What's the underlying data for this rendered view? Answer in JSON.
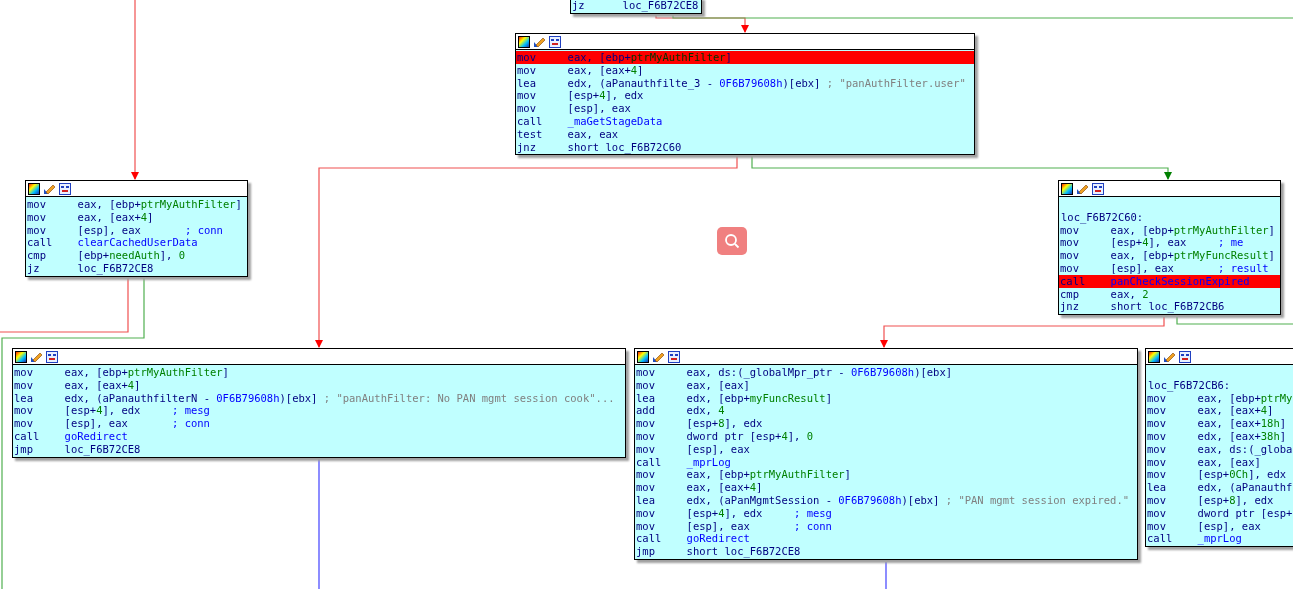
{
  "blocks": [
    {
      "lines": [
        {
          "kind": "instr",
          "mnemonic": "jz",
          "highlighted": false,
          "operands": [
            {
              "t": "loc_F6B72CE8",
              "kind": "op"
            }
          ]
        }
      ]
    },
    {
      "lines": [
        {
          "kind": "instr",
          "mnemonic": "mov",
          "highlighted": true,
          "operands": [
            {
              "t": "eax, [ebp+",
              "kind": "op"
            },
            {
              "t": "ptrMyAuthFilter",
              "kind": "var"
            },
            {
              "t": "]",
              "kind": "op"
            }
          ]
        },
        {
          "kind": "instr",
          "mnemonic": "mov",
          "highlighted": false,
          "operands": [
            {
              "t": "eax, [eax+",
              "kind": "op"
            },
            {
              "t": "4",
              "kind": "var"
            },
            {
              "t": "]",
              "kind": "op"
            }
          ]
        },
        {
          "kind": "instr",
          "mnemonic": "lea",
          "highlighted": false,
          "operands": [
            {
              "t": "edx, (aPanauthfilte_3 - ",
              "kind": "op"
            },
            {
              "t": "0F6B79608h",
              "kind": "func"
            },
            {
              "t": ")[ebx]",
              "kind": "op"
            }
          ],
          "comment": [
            {
              "t": "; \"panAuthFilter.user\"",
              "kind": "string"
            }
          ]
        },
        {
          "kind": "instr",
          "mnemonic": "mov",
          "highlighted": false,
          "operands": [
            {
              "t": "[esp+",
              "kind": "op"
            },
            {
              "t": "4",
              "kind": "var"
            },
            {
              "t": "], edx",
              "kind": "op"
            }
          ]
        },
        {
          "kind": "instr",
          "mnemonic": "mov",
          "highlighted": false,
          "operands": [
            {
              "t": "[esp], eax",
              "kind": "op"
            }
          ]
        },
        {
          "kind": "instr",
          "mnemonic": "call",
          "highlighted": false,
          "operands": [
            {
              "t": "_maGetStageData",
              "kind": "func"
            }
          ]
        },
        {
          "kind": "instr",
          "mnemonic": "test",
          "highlighted": false,
          "operands": [
            {
              "t": "eax, eax",
              "kind": "op"
            }
          ]
        },
        {
          "kind": "instr",
          "mnemonic": "jnz",
          "highlighted": false,
          "operands": [
            {
              "t": "short loc_F6B72C60",
              "kind": "op"
            }
          ]
        }
      ]
    },
    {
      "lines": [
        {
          "kind": "instr",
          "mnemonic": "mov",
          "highlighted": false,
          "operands": [
            {
              "t": "eax, [ebp+",
              "kind": "op"
            },
            {
              "t": "ptrMyAuthFilter",
              "kind": "var"
            },
            {
              "t": "]",
              "kind": "op"
            }
          ]
        },
        {
          "kind": "instr",
          "mnemonic": "mov",
          "highlighted": false,
          "operands": [
            {
              "t": "eax, [eax+",
              "kind": "op"
            },
            {
              "t": "4",
              "kind": "var"
            },
            {
              "t": "]",
              "kind": "op"
            }
          ]
        },
        {
          "kind": "instr",
          "mnemonic": "mov",
          "highlighted": false,
          "operands": [
            {
              "t": "[esp], eax",
              "kind": "op"
            }
          ],
          "comment": [
            {
              "t": "; conn",
              "kind": "comment"
            }
          ]
        },
        {
          "kind": "instr",
          "mnemonic": "call",
          "highlighted": false,
          "operands": [
            {
              "t": "clearCachedUserData",
              "kind": "func"
            }
          ]
        },
        {
          "kind": "instr",
          "mnemonic": "cmp",
          "highlighted": false,
          "operands": [
            {
              "t": "[ebp+",
              "kind": "op"
            },
            {
              "t": "needAuth",
              "kind": "var"
            },
            {
              "t": "], ",
              "kind": "op"
            },
            {
              "t": "0",
              "kind": "var"
            }
          ]
        },
        {
          "kind": "instr",
          "mnemonic": "jz",
          "highlighted": false,
          "operands": [
            {
              "t": "loc_F6B72CE8",
              "kind": "op"
            }
          ]
        }
      ]
    },
    {
      "lines": [
        {
          "kind": "blank"
        },
        {
          "kind": "label",
          "label": "loc_F6B72C60:"
        },
        {
          "kind": "instr",
          "mnemonic": "mov",
          "highlighted": false,
          "operands": [
            {
              "t": "eax, [ebp+",
              "kind": "op"
            },
            {
              "t": "ptrMyAuthFilter",
              "kind": "var"
            },
            {
              "t": "]",
              "kind": "op"
            }
          ]
        },
        {
          "kind": "instr",
          "mnemonic": "mov",
          "highlighted": false,
          "operands": [
            {
              "t": "[esp+",
              "kind": "op"
            },
            {
              "t": "4",
              "kind": "var"
            },
            {
              "t": "], eax",
              "kind": "op"
            }
          ],
          "comment": [
            {
              "t": "; me",
              "kind": "comment"
            }
          ]
        },
        {
          "kind": "instr",
          "mnemonic": "mov",
          "highlighted": false,
          "operands": [
            {
              "t": "eax, [ebp+",
              "kind": "op"
            },
            {
              "t": "ptrMyFuncResult",
              "kind": "var"
            },
            {
              "t": "]",
              "kind": "op"
            }
          ]
        },
        {
          "kind": "instr",
          "mnemonic": "mov",
          "highlighted": false,
          "operands": [
            {
              "t": "[esp], eax",
              "kind": "op"
            }
          ],
          "comment": [
            {
              "t": "; result",
              "kind": "comment"
            }
          ]
        },
        {
          "kind": "instr",
          "mnemonic": "call",
          "highlighted": true,
          "operands": [
            {
              "t": "panCheckSessionExpired",
              "kind": "func"
            }
          ]
        },
        {
          "kind": "instr",
          "mnemonic": "cmp",
          "highlighted": false,
          "operands": [
            {
              "t": "eax, ",
              "kind": "op"
            },
            {
              "t": "2",
              "kind": "var"
            }
          ]
        },
        {
          "kind": "instr",
          "mnemonic": "jnz",
          "highlighted": false,
          "operands": [
            {
              "t": "short loc_F6B72CB6",
              "kind": "op"
            }
          ]
        }
      ]
    },
    {
      "lines": [
        {
          "kind": "instr",
          "mnemonic": "mov",
          "highlighted": false,
          "operands": [
            {
              "t": "eax, [ebp+",
              "kind": "op"
            },
            {
              "t": "ptrMyAuthFilter",
              "kind": "var"
            },
            {
              "t": "]",
              "kind": "op"
            }
          ]
        },
        {
          "kind": "instr",
          "mnemonic": "mov",
          "highlighted": false,
          "operands": [
            {
              "t": "eax, [eax+",
              "kind": "op"
            },
            {
              "t": "4",
              "kind": "var"
            },
            {
              "t": "]",
              "kind": "op"
            }
          ]
        },
        {
          "kind": "instr",
          "mnemonic": "lea",
          "highlighted": false,
          "operands": [
            {
              "t": "edx, (aPanauthfilterN - ",
              "kind": "op"
            },
            {
              "t": "0F6B79608h",
              "kind": "func"
            },
            {
              "t": ")[ebx]",
              "kind": "op"
            }
          ],
          "comment": [
            {
              "t": "; \"panAuthFilter: No PAN mgmt session cook\"...",
              "kind": "string"
            }
          ]
        },
        {
          "kind": "instr",
          "mnemonic": "mov",
          "highlighted": false,
          "operands": [
            {
              "t": "[esp+",
              "kind": "op"
            },
            {
              "t": "4",
              "kind": "var"
            },
            {
              "t": "], edx",
              "kind": "op"
            }
          ],
          "comment": [
            {
              "t": "; mesg",
              "kind": "comment"
            }
          ]
        },
        {
          "kind": "instr",
          "mnemonic": "mov",
          "highlighted": false,
          "operands": [
            {
              "t": "[esp], eax",
              "kind": "op"
            }
          ],
          "comment": [
            {
              "t": "; conn",
              "kind": "comment"
            }
          ]
        },
        {
          "kind": "instr",
          "mnemonic": "call",
          "highlighted": false,
          "operands": [
            {
              "t": "goRedirect",
              "kind": "func"
            }
          ]
        },
        {
          "kind": "instr",
          "mnemonic": "jmp",
          "highlighted": false,
          "operands": [
            {
              "t": "loc_F6B72CE8",
              "kind": "op"
            }
          ]
        }
      ]
    },
    {
      "lines": [
        {
          "kind": "instr",
          "mnemonic": "mov",
          "highlighted": false,
          "operands": [
            {
              "t": "eax, ds:(_globalMpr_ptr - ",
              "kind": "op"
            },
            {
              "t": "0F6B79608h",
              "kind": "func"
            },
            {
              "t": ")[ebx]",
              "kind": "op"
            }
          ]
        },
        {
          "kind": "instr",
          "mnemonic": "mov",
          "highlighted": false,
          "operands": [
            {
              "t": "eax, [eax]",
              "kind": "op"
            }
          ]
        },
        {
          "kind": "instr",
          "mnemonic": "lea",
          "highlighted": false,
          "operands": [
            {
              "t": "edx, [ebp+",
              "kind": "op"
            },
            {
              "t": "myFuncResult",
              "kind": "var"
            },
            {
              "t": "]",
              "kind": "op"
            }
          ]
        },
        {
          "kind": "instr",
          "mnemonic": "add",
          "highlighted": false,
          "operands": [
            {
              "t": "edx, ",
              "kind": "op"
            },
            {
              "t": "4",
              "kind": "var"
            }
          ]
        },
        {
          "kind": "instr",
          "mnemonic": "mov",
          "highlighted": false,
          "operands": [
            {
              "t": "[esp+",
              "kind": "op"
            },
            {
              "t": "8",
              "kind": "var"
            },
            {
              "t": "], edx",
              "kind": "op"
            }
          ]
        },
        {
          "kind": "instr",
          "mnemonic": "mov",
          "highlighted": false,
          "operands": [
            {
              "t": "dword ptr [esp+",
              "kind": "op"
            },
            {
              "t": "4",
              "kind": "var"
            },
            {
              "t": "], ",
              "kind": "op"
            },
            {
              "t": "0",
              "kind": "var"
            }
          ]
        },
        {
          "kind": "instr",
          "mnemonic": "mov",
          "highlighted": false,
          "operands": [
            {
              "t": "[esp], eax",
              "kind": "op"
            }
          ]
        },
        {
          "kind": "instr",
          "mnemonic": "call",
          "highlighted": false,
          "operands": [
            {
              "t": "_mprLog",
              "kind": "func"
            }
          ]
        },
        {
          "kind": "instr",
          "mnemonic": "mov",
          "highlighted": false,
          "operands": [
            {
              "t": "eax, [ebp+",
              "kind": "op"
            },
            {
              "t": "ptrMyAuthFilter",
              "kind": "var"
            },
            {
              "t": "]",
              "kind": "op"
            }
          ]
        },
        {
          "kind": "instr",
          "mnemonic": "mov",
          "highlighted": false,
          "operands": [
            {
              "t": "eax, [eax+",
              "kind": "op"
            },
            {
              "t": "4",
              "kind": "var"
            },
            {
              "t": "]",
              "kind": "op"
            }
          ]
        },
        {
          "kind": "instr",
          "mnemonic": "lea",
          "highlighted": false,
          "operands": [
            {
              "t": "edx, (aPanMgmtSession - ",
              "kind": "op"
            },
            {
              "t": "0F6B79608h",
              "kind": "func"
            },
            {
              "t": ")[ebx]",
              "kind": "op"
            }
          ],
          "comment": [
            {
              "t": "; \"PAN mgmt session expired.\"",
              "kind": "string"
            }
          ]
        },
        {
          "kind": "instr",
          "mnemonic": "mov",
          "highlighted": false,
          "operands": [
            {
              "t": "[esp+",
              "kind": "op"
            },
            {
              "t": "4",
              "kind": "var"
            },
            {
              "t": "], edx",
              "kind": "op"
            }
          ],
          "comment": [
            {
              "t": "; mesg",
              "kind": "comment"
            }
          ]
        },
        {
          "kind": "instr",
          "mnemonic": "mov",
          "highlighted": false,
          "operands": [
            {
              "t": "[esp], eax",
              "kind": "op"
            }
          ],
          "comment": [
            {
              "t": "; conn",
              "kind": "comment"
            }
          ]
        },
        {
          "kind": "instr",
          "mnemonic": "call",
          "highlighted": false,
          "operands": [
            {
              "t": "goRedirect",
              "kind": "func"
            }
          ]
        },
        {
          "kind": "instr",
          "mnemonic": "jmp",
          "highlighted": false,
          "operands": [
            {
              "t": "short loc_F6B72CE8",
              "kind": "op"
            }
          ]
        }
      ]
    },
    {
      "lines": [
        {
          "kind": "blank"
        },
        {
          "kind": "label",
          "label": "loc_F6B72CB6:"
        },
        {
          "kind": "instr",
          "mnemonic": "mov",
          "highlighted": false,
          "operands": [
            {
              "t": "eax, [ebp+",
              "kind": "op"
            },
            {
              "t": "ptrMy",
              "kind": "var"
            }
          ]
        },
        {
          "kind": "instr",
          "mnemonic": "mov",
          "highlighted": false,
          "operands": [
            {
              "t": "eax, [eax+",
              "kind": "op"
            },
            {
              "t": "4",
              "kind": "var"
            },
            {
              "t": "]",
              "kind": "op"
            }
          ]
        },
        {
          "kind": "instr",
          "mnemonic": "mov",
          "highlighted": false,
          "operands": [
            {
              "t": "eax, [eax+",
              "kind": "op"
            },
            {
              "t": "18h",
              "kind": "var"
            },
            {
              "t": "]",
              "kind": "op"
            }
          ]
        },
        {
          "kind": "instr",
          "mnemonic": "mov",
          "highlighted": false,
          "operands": [
            {
              "t": "edx, [eax+",
              "kind": "op"
            },
            {
              "t": "38h",
              "kind": "var"
            },
            {
              "t": "]",
              "kind": "op"
            }
          ]
        },
        {
          "kind": "instr",
          "mnemonic": "mov",
          "highlighted": false,
          "operands": [
            {
              "t": "eax, ds:(_globa",
              "kind": "op"
            }
          ]
        },
        {
          "kind": "instr",
          "mnemonic": "mov",
          "highlighted": false,
          "operands": [
            {
              "t": "eax, [eax]",
              "kind": "op"
            }
          ]
        },
        {
          "kind": "instr",
          "mnemonic": "mov",
          "highlighted": false,
          "operands": [
            {
              "t": "[esp+",
              "kind": "op"
            },
            {
              "t": "0Ch",
              "kind": "var"
            },
            {
              "t": "], edx",
              "kind": "op"
            }
          ]
        },
        {
          "kind": "instr",
          "mnemonic": "lea",
          "highlighted": false,
          "operands": [
            {
              "t": "edx, (aPanauthf",
              "kind": "op"
            }
          ]
        },
        {
          "kind": "instr",
          "mnemonic": "mov",
          "highlighted": false,
          "operands": [
            {
              "t": "[esp+",
              "kind": "op"
            },
            {
              "t": "8",
              "kind": "var"
            },
            {
              "t": "], edx",
              "kind": "op"
            }
          ]
        },
        {
          "kind": "instr",
          "mnemonic": "mov",
          "highlighted": false,
          "operands": [
            {
              "t": "dword ptr [esp+",
              "kind": "op"
            }
          ]
        },
        {
          "kind": "instr",
          "mnemonic": "mov",
          "highlighted": false,
          "operands": [
            {
              "t": "[esp], eax",
              "kind": "op"
            }
          ]
        },
        {
          "kind": "instr",
          "mnemonic": "call",
          "highlighted": false,
          "operands": [
            {
              "t": "_mprLog",
              "kind": "func"
            }
          ]
        }
      ]
    }
  ]
}
